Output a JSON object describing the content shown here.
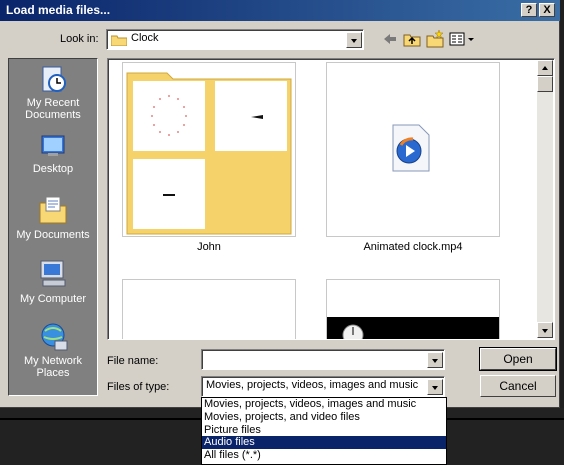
{
  "dialog": {
    "title": "Load media files...",
    "help_label": "?",
    "close_label": "X"
  },
  "lookin": {
    "label": "Look in:",
    "value": "Clock"
  },
  "toolbar": {
    "back_icon": "back-arrow-icon",
    "up_icon": "up-folder-icon",
    "newfolder_icon": "new-folder-icon",
    "views_icon": "views-menu-icon"
  },
  "places": [
    {
      "label": "My Recent Documents",
      "icon": "recent-documents-icon"
    },
    {
      "label": "Desktop",
      "icon": "desktop-icon"
    },
    {
      "label": "My Documents",
      "icon": "my-documents-icon"
    },
    {
      "label": "My Computer",
      "icon": "my-computer-icon"
    },
    {
      "label": "My Network Places",
      "icon": "network-places-icon"
    }
  ],
  "files": [
    {
      "name": "John",
      "type": "folder"
    },
    {
      "name": "Animated clock.mp4",
      "type": "media"
    }
  ],
  "filename": {
    "label": "File name:",
    "value": ""
  },
  "filetype": {
    "label": "Files of type:",
    "value": "Movies, projects, videos, images and music",
    "options": [
      "Movies, projects, videos, images and music",
      "Movies, projects, and video files",
      "Picture files",
      "Audio files",
      "All files (*.*)"
    ],
    "highlighted_index": 3
  },
  "buttons": {
    "open": "Open",
    "cancel": "Cancel"
  },
  "colors": {
    "title_bar": "#0a246a",
    "selection": "#0a246a",
    "face": "#d4d0c8"
  }
}
